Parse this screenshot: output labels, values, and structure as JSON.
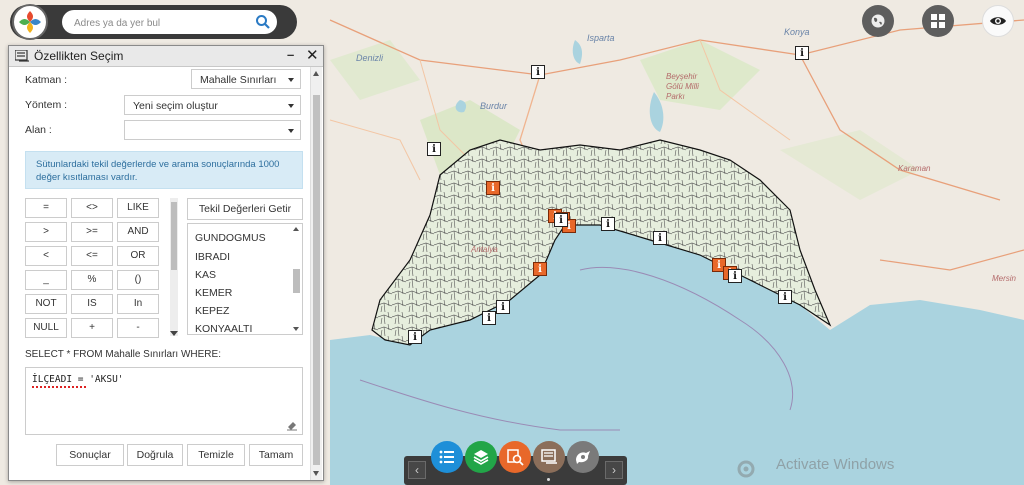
{
  "search": {
    "placeholder": "Adres ya da yer bul"
  },
  "map": {
    "places": [
      "Konya",
      "Isparta",
      "Denizli",
      "Burdur",
      "Beyşehir Gölü Milli Parkı",
      "Karaman",
      "Mersin",
      "Antalya"
    ]
  },
  "panel": {
    "title": "Özellikten Seçim",
    "minimize": "–",
    "close": "✕",
    "layer_label": "Katman :",
    "layer_value": "Mahalle Sınırları",
    "method_label": "Yöntem :",
    "method_value": "Yeni seçim oluştur",
    "field_label": "Alan :",
    "field_value": "",
    "info": "Sütunlardaki tekil değerlerde ve arama sonuçlarında 1000 değer kısıtlaması vardır.",
    "operators": [
      "=",
      "<>",
      "LIKE",
      ">",
      ">=",
      "AND",
      "<",
      "<=",
      "OR",
      "_",
      "%",
      "()",
      "NOT",
      "IS",
      "In",
      "NULL",
      "+",
      "-"
    ],
    "unique_button": "Tekil Değerleri Getir",
    "unique_values": [
      "GUNDOGMUS",
      "IBRADI",
      "KAS",
      "KEMER",
      "KEPEZ",
      "KONYAALTI"
    ],
    "sql_label": "SELECT * FROM Mahalle Sınırları WHERE:",
    "sql_text": "İLÇEADI = 'AKSU'",
    "actions": [
      "Sonuçlar",
      "Doğrula",
      "Temizle",
      "Tamam"
    ]
  },
  "toolbar": {
    "prev": "‹",
    "next": "›",
    "tools": [
      "list-icon",
      "layers-icon",
      "query-icon",
      "select-icon",
      "measure-icon"
    ],
    "tool_colors": [
      "#1e8fd8",
      "#22a548",
      "#e8682a",
      "#8b6e5a",
      "#7a7a7a"
    ]
  },
  "watermark": "Activate Windows",
  "colors": {
    "panel_info_bg": "#d8ebf6",
    "poi_orange": "#e8682a",
    "sea": "#aad3df"
  }
}
